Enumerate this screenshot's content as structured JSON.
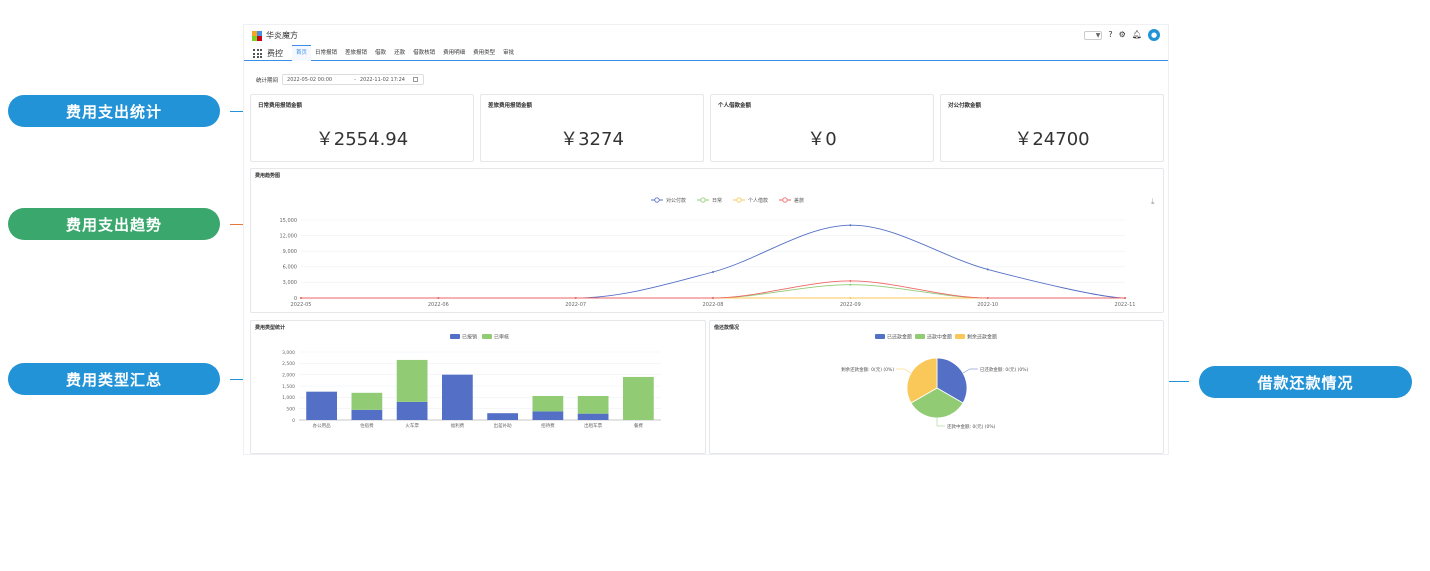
{
  "callouts": {
    "expense_stats": "费用支出统计",
    "expense_trend": "费用支出趋势",
    "type_summary": "费用类型汇总",
    "loan_repay": "借款还款情况"
  },
  "app": {
    "title": "华炎魔方",
    "brand": "费控",
    "nav_tabs": [
      "首页",
      "日常报销",
      "差旅报销",
      "借款",
      "还款",
      "借款核销",
      "费用明细",
      "费用类型",
      "审批"
    ],
    "lang_placeholder": "▼",
    "icons": [
      "question-icon",
      "gear-icon",
      "bell-icon",
      "user-avatar-icon"
    ]
  },
  "period": {
    "label": "统计期间",
    "start": "2022-05-02 00:00",
    "end": "2022-11-02 17:24"
  },
  "stats": [
    {
      "label": "日常费用报销金额",
      "value": "￥2554.94"
    },
    {
      "label": "差旅费用报销金额",
      "value": "￥3274"
    },
    {
      "label": "个人借款金额",
      "value": "￥0"
    },
    {
      "label": "对公付款金额",
      "value": "￥24700"
    }
  ],
  "colors": {
    "blue": "#5470c6",
    "green": "#91cc75",
    "yellow": "#fac858",
    "red": "#ee6666",
    "accent": "#3a8ee6"
  },
  "trend_panel": {
    "title": "费用趋势图"
  },
  "type_panel": {
    "title": "费用类型统计"
  },
  "loan_panel": {
    "title": "借还款情况"
  },
  "chart_data": [
    {
      "type": "line",
      "x": [
        "2022-05",
        "2022-06",
        "2022-07",
        "2022-08",
        "2022-09",
        "2022-10",
        "2022-11"
      ],
      "series": [
        {
          "name": "对公付款",
          "values": [
            0,
            0,
            0,
            5000,
            14000,
            5500,
            0
          ]
        },
        {
          "name": "日常",
          "values": [
            0,
            0,
            0,
            0,
            2555,
            0,
            0
          ]
        },
        {
          "name": "个人借款",
          "values": [
            0,
            0,
            0,
            0,
            0,
            0,
            0
          ]
        },
        {
          "name": "差旅",
          "values": [
            0,
            0,
            0,
            0,
            3274,
            0,
            0
          ]
        }
      ],
      "ylim": [
        0,
        15000
      ],
      "yticks": [
        "0",
        "3,000",
        "6,000",
        "9,000",
        "12,000",
        "15,000"
      ],
      "ytick_values": [
        0,
        3000,
        6000,
        9000,
        12000,
        15000
      ],
      "legend": "top-center",
      "grid": true
    },
    {
      "type": "bar",
      "categories": [
        "办公用品",
        "住宿费",
        "火车票",
        "福利费",
        "出差补助",
        "招待费",
        "出租车票",
        "餐费"
      ],
      "series": [
        {
          "name": "已报销",
          "values": [
            1250,
            450,
            800,
            2000,
            300,
            380,
            280,
            0
          ]
        },
        {
          "name": "已审核",
          "values": [
            0,
            750,
            1850,
            0,
            0,
            680,
            780,
            1900
          ]
        }
      ],
      "ylim": [
        0,
        3000
      ],
      "yticks": [
        "0",
        "500",
        "1,000",
        "1,500",
        "2,000",
        "2,500",
        "3,000"
      ],
      "ytick_values": [
        0,
        500,
        1000,
        1500,
        2000,
        2500,
        3000
      ],
      "legend": "top-center",
      "grid": true
    },
    {
      "type": "pie",
      "series": [
        {
          "name": "已还款金额",
          "value": 1
        },
        {
          "name": "还款中金额",
          "value": 1
        },
        {
          "name": "剩余还款金额",
          "value": 1
        }
      ],
      "labels": [
        "已还款金额: 0(元) (0%)",
        "还款中金额: 0(元) (0%)",
        "剩余还款金额: 0(元) (0%)"
      ],
      "legend": "top-center"
    }
  ]
}
